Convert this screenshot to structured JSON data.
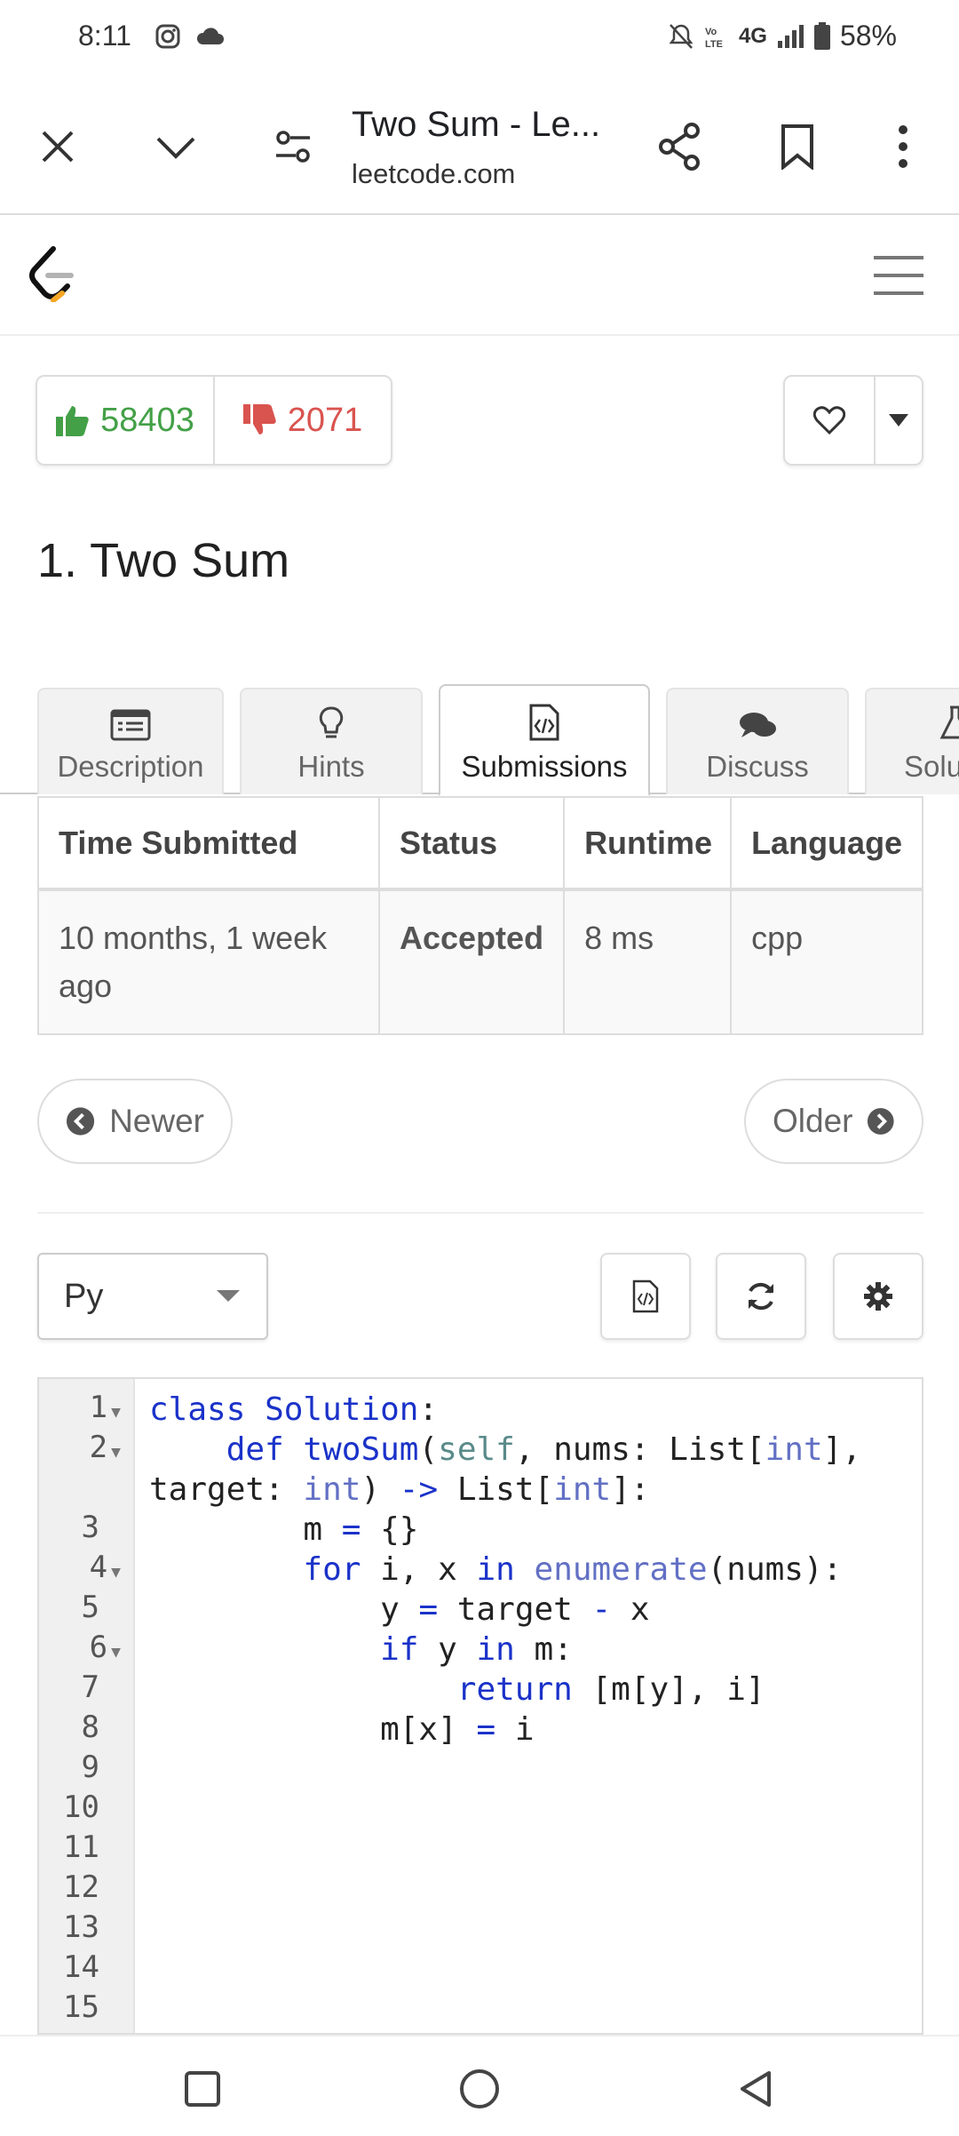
{
  "status_bar": {
    "time": "8:11",
    "battery": "58%",
    "network": "4G"
  },
  "browser": {
    "title": "Two Sum - Le...",
    "url": "leetcode.com"
  },
  "votes": {
    "likes": "58403",
    "dislikes": "2071"
  },
  "problem": {
    "title": "1. Two Sum"
  },
  "tabs": [
    {
      "label": "Description",
      "icon": "description-icon",
      "active": false
    },
    {
      "label": "Hints",
      "icon": "lightbulb-icon",
      "active": false
    },
    {
      "label": "Submissions",
      "icon": "code-file-icon",
      "active": true
    },
    {
      "label": "Discuss",
      "icon": "comments-icon",
      "active": false
    },
    {
      "label": "Solu",
      "icon": "flask-icon",
      "active": false
    }
  ],
  "submissions": {
    "headers": [
      "Time Submitted",
      "Status",
      "Runtime",
      "Language"
    ],
    "rows": [
      {
        "time": "10 months, 1 week ago",
        "status": "Accepted",
        "runtime": "8 ms",
        "language": "cpp"
      }
    ]
  },
  "pager": {
    "newer": "Newer",
    "older": "Older"
  },
  "editor": {
    "language": "Py",
    "line_numbers": [
      "1",
      "2",
      "3",
      "4",
      "5",
      "6",
      "7",
      "8",
      "9",
      "10",
      "11",
      "12",
      "13",
      "14",
      "15"
    ],
    "lines": [
      "class Solution:",
      "    def twoSum(self, nums: List[int],",
      "target: int) -> List[int]:",
      "        m = {}",
      "        for i, x in enumerate(nums):",
      "            y = target - x",
      "            if y in m:",
      "                return [m[y], i]",
      "            m[x] = i"
    ]
  },
  "colors": {
    "accepted": "#43a047",
    "like": "#43a047",
    "dislike": "#d9534f",
    "keyword": "#1a32c9"
  }
}
